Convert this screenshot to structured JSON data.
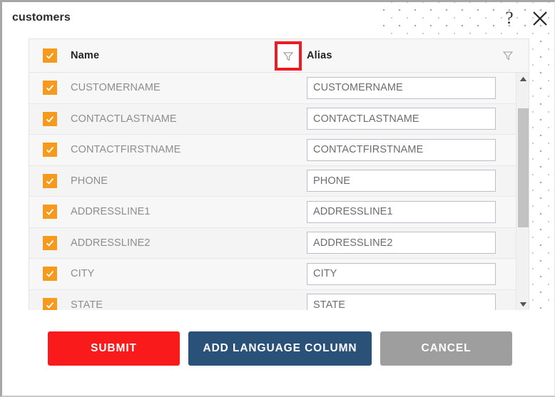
{
  "dialog": {
    "title": "customers",
    "help_icon": "question-mark-icon",
    "help_label": "?",
    "close_icon": "close-icon"
  },
  "table": {
    "columns": [
      {
        "key": "check",
        "label": "",
        "icon": "checkbox-icon"
      },
      {
        "key": "name",
        "label": "Name",
        "filter_icon": "filter-funnel-icon",
        "filter_highlighted": true
      },
      {
        "key": "alias",
        "label": "Alias",
        "filter_icon": "filter-funnel-icon",
        "filter_highlighted": false
      }
    ],
    "header_select_all_checked": true,
    "rows": [
      {
        "checked": true,
        "name": "CUSTOMERNAME",
        "alias": "CUSTOMERNAME"
      },
      {
        "checked": true,
        "name": "CONTACTLASTNAME",
        "alias": "CONTACTLASTNAME"
      },
      {
        "checked": true,
        "name": "CONTACTFIRSTNAME",
        "alias": "CONTACTFIRSTNAME"
      },
      {
        "checked": true,
        "name": "PHONE",
        "alias": "PHONE"
      },
      {
        "checked": true,
        "name": "ADDRESSLINE1",
        "alias": "ADDRESSLINE1"
      },
      {
        "checked": true,
        "name": "ADDRESSLINE2",
        "alias": "ADDRESSLINE2"
      },
      {
        "checked": true,
        "name": "CITY",
        "alias": "CITY"
      },
      {
        "checked": true,
        "name": "STATE",
        "alias": "STATE"
      }
    ]
  },
  "scrollbar": {
    "up_icon": "triangle-up-icon",
    "down_icon": "triangle-down-icon",
    "thumb_name": "scrollbar-thumb"
  },
  "footer": {
    "submit_label": "SUBMIT",
    "add_language_column_label": "ADD LANGUAGE COLUMN",
    "cancel_label": "CANCEL"
  },
  "colors": {
    "submit": "#f91b1b",
    "add_language": "#2a5279",
    "cancel": "#9e9e9e",
    "checkbox": "#f59a1c",
    "highlight_box": "#ee1b24",
    "dot_pattern": "#9aa6dd",
    "table_bg": "#f7f7f7"
  }
}
